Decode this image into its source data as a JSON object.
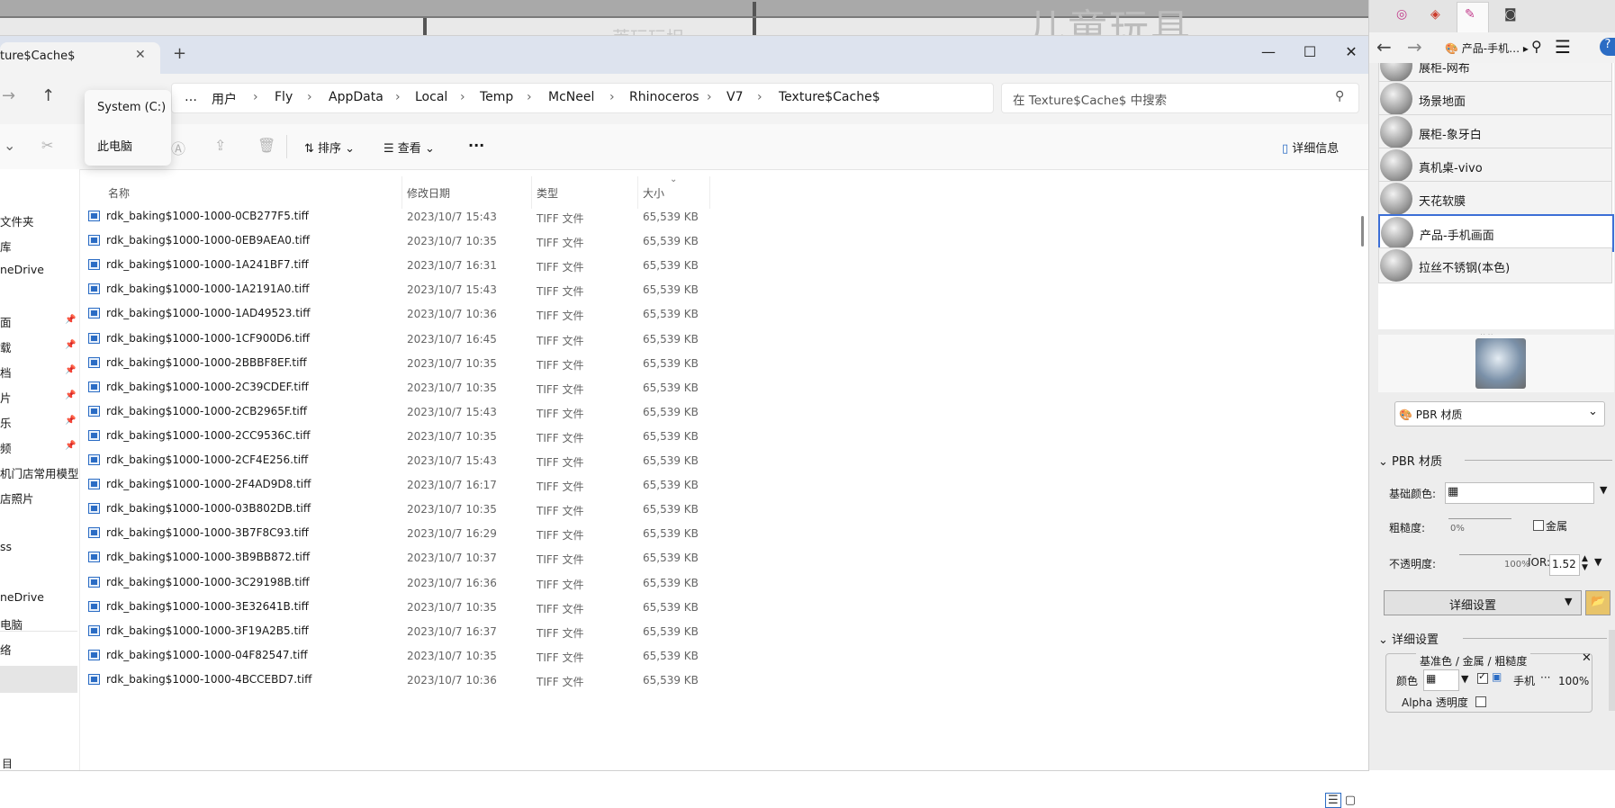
{
  "background": {
    "watermark": "儿童玩具",
    "faded_text": "莱玩玩坦"
  },
  "explorer": {
    "tab_title": "ture$Cache$",
    "window_buttons": {
      "minimize": "—",
      "maximize": "☐",
      "close": "✕"
    },
    "breadcrumb": [
      "…",
      "用户",
      "Fly",
      "AppData",
      "Local",
      "Temp",
      "McNeel",
      "Rhinoceros",
      "V7",
      "Texture$Cache$"
    ],
    "search_placeholder": "在 Texture$Cache$ 中搜索",
    "drive_popup": [
      "System (C:)",
      "此电脑"
    ],
    "commands": {
      "sort": "排序",
      "view": "查看",
      "more": "···",
      "details": "详细信息"
    },
    "sidebar": [
      {
        "label": "文件夹",
        "pinned": false
      },
      {
        "label": "库",
        "pinned": false
      },
      {
        "label": "neDrive",
        "pinned": false
      },
      {
        "label": "面",
        "pinned": true
      },
      {
        "label": "载",
        "pinned": true
      },
      {
        "label": "档",
        "pinned": true
      },
      {
        "label": "片",
        "pinned": true
      },
      {
        "label": "乐",
        "pinned": true
      },
      {
        "label": "频",
        "pinned": true
      },
      {
        "label": "机门店常用模型",
        "pinned": false
      },
      {
        "label": "店照片",
        "pinned": false
      },
      {
        "label": "",
        "pinned": false
      },
      {
        "label": "ss",
        "pinned": false
      },
      {
        "label": "neDrive",
        "pinned": false
      },
      {
        "label": "电脑",
        "pinned": false
      },
      {
        "label": "络",
        "pinned": false
      }
    ],
    "columns": {
      "name": "名称",
      "date": "修改日期",
      "type": "类型",
      "size": "大小"
    },
    "files": [
      {
        "name": "rdk_baking$1000-1000-0CB277F5.tiff",
        "date": "2023/10/7 15:43",
        "type": "TIFF 文件",
        "size": "65,539 KB"
      },
      {
        "name": "rdk_baking$1000-1000-0EB9AEA0.tiff",
        "date": "2023/10/7 10:35",
        "type": "TIFF 文件",
        "size": "65,539 KB"
      },
      {
        "name": "rdk_baking$1000-1000-1A241BF7.tiff",
        "date": "2023/10/7 16:31",
        "type": "TIFF 文件",
        "size": "65,539 KB"
      },
      {
        "name": "rdk_baking$1000-1000-1A2191A0.tiff",
        "date": "2023/10/7 15:43",
        "type": "TIFF 文件",
        "size": "65,539 KB"
      },
      {
        "name": "rdk_baking$1000-1000-1AD49523.tiff",
        "date": "2023/10/7 10:36",
        "type": "TIFF 文件",
        "size": "65,539 KB"
      },
      {
        "name": "rdk_baking$1000-1000-1CF900D6.tiff",
        "date": "2023/10/7 16:45",
        "type": "TIFF 文件",
        "size": "65,539 KB"
      },
      {
        "name": "rdk_baking$1000-1000-2BBBF8EF.tiff",
        "date": "2023/10/7 10:35",
        "type": "TIFF 文件",
        "size": "65,539 KB"
      },
      {
        "name": "rdk_baking$1000-1000-2C39CDEF.tiff",
        "date": "2023/10/7 10:35",
        "type": "TIFF 文件",
        "size": "65,539 KB"
      },
      {
        "name": "rdk_baking$1000-1000-2CB2965F.tiff",
        "date": "2023/10/7 15:43",
        "type": "TIFF 文件",
        "size": "65,539 KB"
      },
      {
        "name": "rdk_baking$1000-1000-2CC9536C.tiff",
        "date": "2023/10/7 10:35",
        "type": "TIFF 文件",
        "size": "65,539 KB"
      },
      {
        "name": "rdk_baking$1000-1000-2CF4E256.tiff",
        "date": "2023/10/7 15:43",
        "type": "TIFF 文件",
        "size": "65,539 KB"
      },
      {
        "name": "rdk_baking$1000-1000-2F4AD9D8.tiff",
        "date": "2023/10/7 16:17",
        "type": "TIFF 文件",
        "size": "65,539 KB"
      },
      {
        "name": "rdk_baking$1000-1000-03B802DB.tiff",
        "date": "2023/10/7 10:35",
        "type": "TIFF 文件",
        "size": "65,539 KB"
      },
      {
        "name": "rdk_baking$1000-1000-3B7F8C93.tiff",
        "date": "2023/10/7 16:29",
        "type": "TIFF 文件",
        "size": "65,539 KB"
      },
      {
        "name": "rdk_baking$1000-1000-3B9BB872.tiff",
        "date": "2023/10/7 10:37",
        "type": "TIFF 文件",
        "size": "65,539 KB"
      },
      {
        "name": "rdk_baking$1000-1000-3C29198B.tiff",
        "date": "2023/10/7 16:36",
        "type": "TIFF 文件",
        "size": "65,539 KB"
      },
      {
        "name": "rdk_baking$1000-1000-3E32641B.tiff",
        "date": "2023/10/7 10:35",
        "type": "TIFF 文件",
        "size": "65,539 KB"
      },
      {
        "name": "rdk_baking$1000-1000-3F19A2B5.tiff",
        "date": "2023/10/7 16:37",
        "type": "TIFF 文件",
        "size": "65,539 KB"
      },
      {
        "name": "rdk_baking$1000-1000-04F82547.tiff",
        "date": "2023/10/7 10:35",
        "type": "TIFF 文件",
        "size": "65,539 KB"
      },
      {
        "name": "rdk_baking$1000-1000-4BCCEBD7.tiff",
        "date": "2023/10/7 10:36",
        "type": "TIFF 文件",
        "size": "65,539 KB"
      }
    ],
    "status_left": "目"
  },
  "rhino_panel": {
    "nav_title": "产品-手机…",
    "materials": [
      "展柜-网布",
      "场景地面",
      "展柜-象牙白",
      "真机桌-vivo",
      "天花软膜",
      "产品-手机画面",
      "拉丝不锈钢(本色)"
    ],
    "selected_material": "产品-手机画面",
    "material_type": "PBR 材质",
    "section_title": "PBR 材质",
    "base_color_label": "基础颜色:",
    "roughness_label": "粗糙度:",
    "roughness_value": "0%",
    "metal_label": "金属",
    "opacity_label": "不透明度:",
    "opacity_value": "100%",
    "ior_label": "IOR:",
    "ior_value": "1.52",
    "detail_button": "详细设置",
    "detail_section": "详细设置",
    "sub_group_title": "基准色 / 金属 / 粗糙度",
    "color_label": "颜色",
    "texture_name": "手机",
    "amount_value": "100%",
    "alpha_label": "Alpha 透明度"
  }
}
